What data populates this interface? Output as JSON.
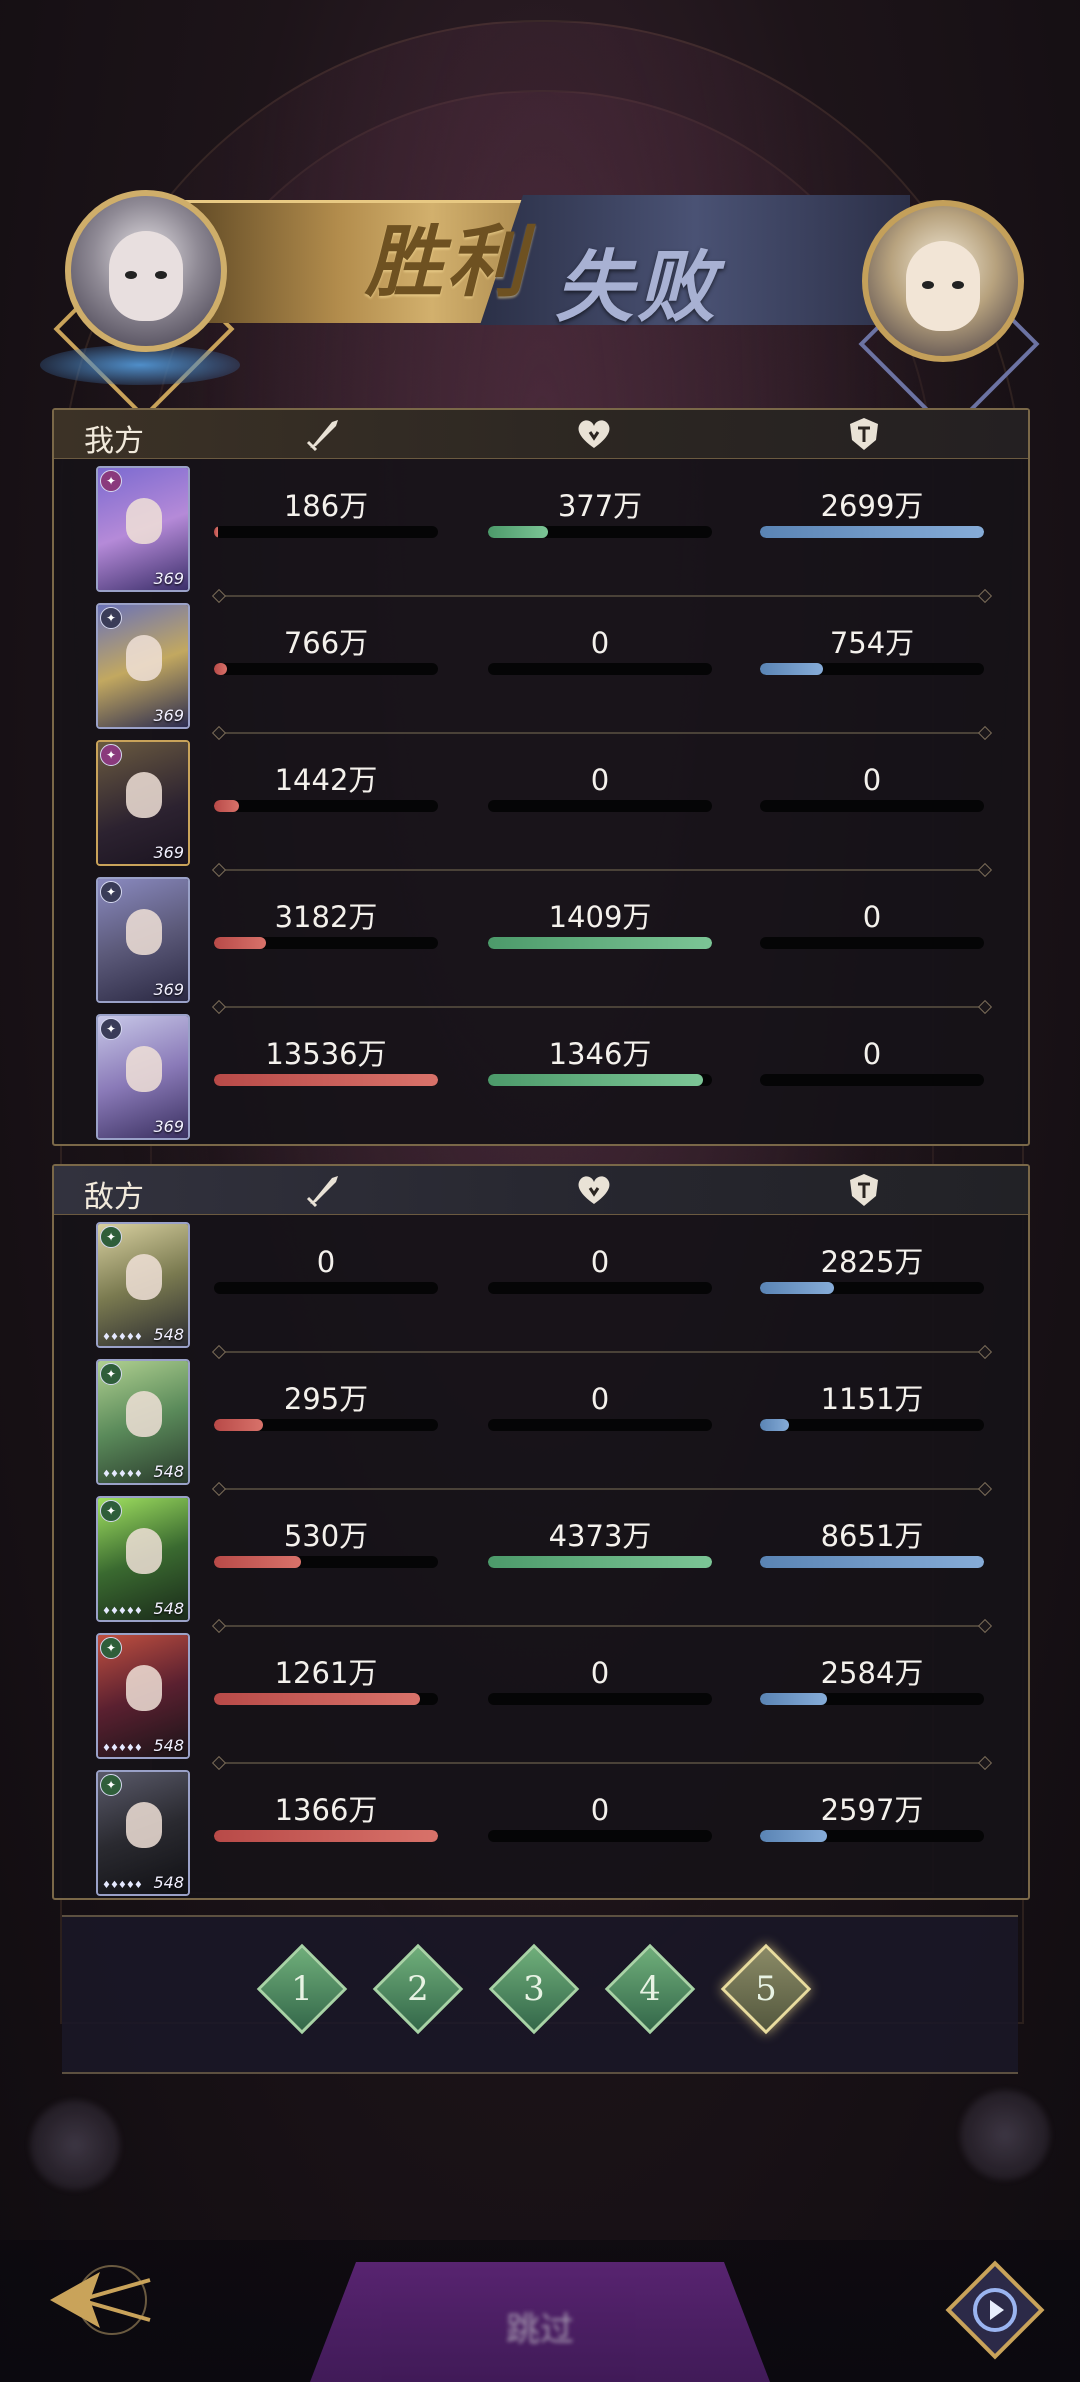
{
  "banner": {
    "victory_text": "胜利",
    "defeat_text": "失败"
  },
  "panels": [
    {
      "title": "我方",
      "rows": [
        {
          "level": "369",
          "badge": "pink",
          "frame": "purple",
          "atk": {
            "label": "186万",
            "pct": 0.02
          },
          "heal": {
            "label": "377万",
            "pct": 0.27
          },
          "def": {
            "label": "2699万",
            "pct": 1.0
          }
        },
        {
          "level": "369",
          "badge": "blue",
          "frame": "purple",
          "atk": {
            "label": "766万",
            "pct": 0.06
          },
          "heal": {
            "label": "0",
            "pct": 0
          },
          "def": {
            "label": "754万",
            "pct": 0.28
          }
        },
        {
          "level": "369",
          "badge": "pink",
          "frame": "gold",
          "atk": {
            "label": "1442万",
            "pct": 0.11
          },
          "heal": {
            "label": "0",
            "pct": 0
          },
          "def": {
            "label": "0",
            "pct": 0
          }
        },
        {
          "level": "369",
          "badge": "blue",
          "frame": "purple",
          "atk": {
            "label": "3182万",
            "pct": 0.23
          },
          "heal": {
            "label": "1409万",
            "pct": 1.0
          },
          "def": {
            "label": "0",
            "pct": 0
          }
        },
        {
          "level": "369",
          "badge": "blue",
          "frame": "purple",
          "atk": {
            "label": "13536万",
            "pct": 1.0
          },
          "heal": {
            "label": "1346万",
            "pct": 0.96
          },
          "def": {
            "label": "0",
            "pct": 0
          }
        }
      ]
    },
    {
      "title": "敌方",
      "rows": [
        {
          "level": "548",
          "badge": "green",
          "frame": "purple",
          "atk": {
            "label": "0",
            "pct": 0
          },
          "heal": {
            "label": "0",
            "pct": 0
          },
          "def": {
            "label": "2825万",
            "pct": 0.33
          }
        },
        {
          "level": "548",
          "badge": "green",
          "frame": "purple",
          "atk": {
            "label": "295万",
            "pct": 0.22
          },
          "heal": {
            "label": "0",
            "pct": 0
          },
          "def": {
            "label": "1151万",
            "pct": 0.13
          }
        },
        {
          "level": "548",
          "badge": "green",
          "frame": "purple",
          "atk": {
            "label": "530万",
            "pct": 0.39
          },
          "heal": {
            "label": "4373万",
            "pct": 1.0
          },
          "def": {
            "label": "8651万",
            "pct": 1.0
          }
        },
        {
          "level": "548",
          "badge": "green",
          "frame": "purple",
          "atk": {
            "label": "1261万",
            "pct": 0.92
          },
          "heal": {
            "label": "0",
            "pct": 0
          },
          "def": {
            "label": "2584万",
            "pct": 0.3
          }
        },
        {
          "level": "548",
          "badge": "green",
          "frame": "purple",
          "atk": {
            "label": "1366万",
            "pct": 1.0
          },
          "heal": {
            "label": "0",
            "pct": 0
          },
          "def": {
            "label": "2597万",
            "pct": 0.3
          }
        }
      ]
    }
  ],
  "rounds": {
    "labels": [
      "1",
      "2",
      "3",
      "4",
      "5"
    ],
    "active_index": 4
  },
  "bottom": {
    "skip_label": "跳过"
  },
  "icons": {
    "attack": "sword-icon",
    "heal": "heart-icon",
    "defense": "shield-icon",
    "back": "back-arrow-icon",
    "replay": "replay-icon"
  },
  "colors": {
    "attack_bar": "#c8605c",
    "heal_bar": "#6cb486",
    "defense_bar": "#7199c8",
    "panel_border": "#7a6848",
    "victory_gold": "#d2b06d",
    "defeat_blue": "#4a5274"
  }
}
